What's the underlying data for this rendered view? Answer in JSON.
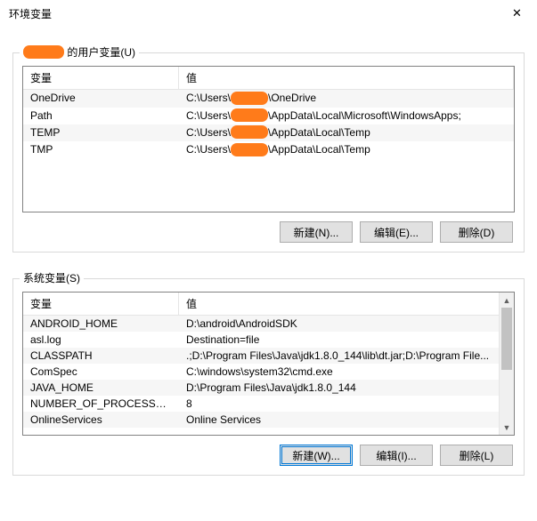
{
  "window": {
    "title": "环境变量",
    "close_glyph": "✕"
  },
  "userSection": {
    "label_suffix": " 的用户变量(U)",
    "columns": {
      "var": "变量",
      "val": "值"
    },
    "rows": [
      {
        "var": "OneDrive",
        "val_pre": "C:\\Users\\",
        "val_post": "\\OneDrive"
      },
      {
        "var": "Path",
        "val_pre": "C:\\Users\\",
        "val_post": "\\AppData\\Local\\Microsoft\\WindowsApps;"
      },
      {
        "var": "TEMP",
        "val_pre": "C:\\Users\\",
        "val_post": "\\AppData\\Local\\Temp"
      },
      {
        "var": "TMP",
        "val_pre": "C:\\Users\\",
        "val_post": "\\AppData\\Local\\Temp"
      }
    ],
    "buttons": {
      "new": "新建(N)...",
      "edit": "编辑(E)...",
      "delete": "删除(D)"
    }
  },
  "sysSection": {
    "label": "系统变量(S)",
    "columns": {
      "var": "变量",
      "val": "值"
    },
    "rows": [
      {
        "var": "ANDROID_HOME",
        "val": "D:\\android\\AndroidSDK"
      },
      {
        "var": "asl.log",
        "val": "Destination=file"
      },
      {
        "var": "CLASSPATH",
        "val": ".;D:\\Program Files\\Java\\jdk1.8.0_144\\lib\\dt.jar;D:\\Program File..."
      },
      {
        "var": "ComSpec",
        "val": "C:\\windows\\system32\\cmd.exe"
      },
      {
        "var": "JAVA_HOME",
        "val": "D:\\Program Files\\Java\\jdk1.8.0_144"
      },
      {
        "var": "NUMBER_OF_PROCESSORS",
        "val": "8"
      },
      {
        "var": "OnlineServices",
        "val": "Online Services"
      }
    ],
    "buttons": {
      "new": "新建(W)...",
      "edit": "编辑(I)...",
      "delete": "删除(L)"
    }
  }
}
